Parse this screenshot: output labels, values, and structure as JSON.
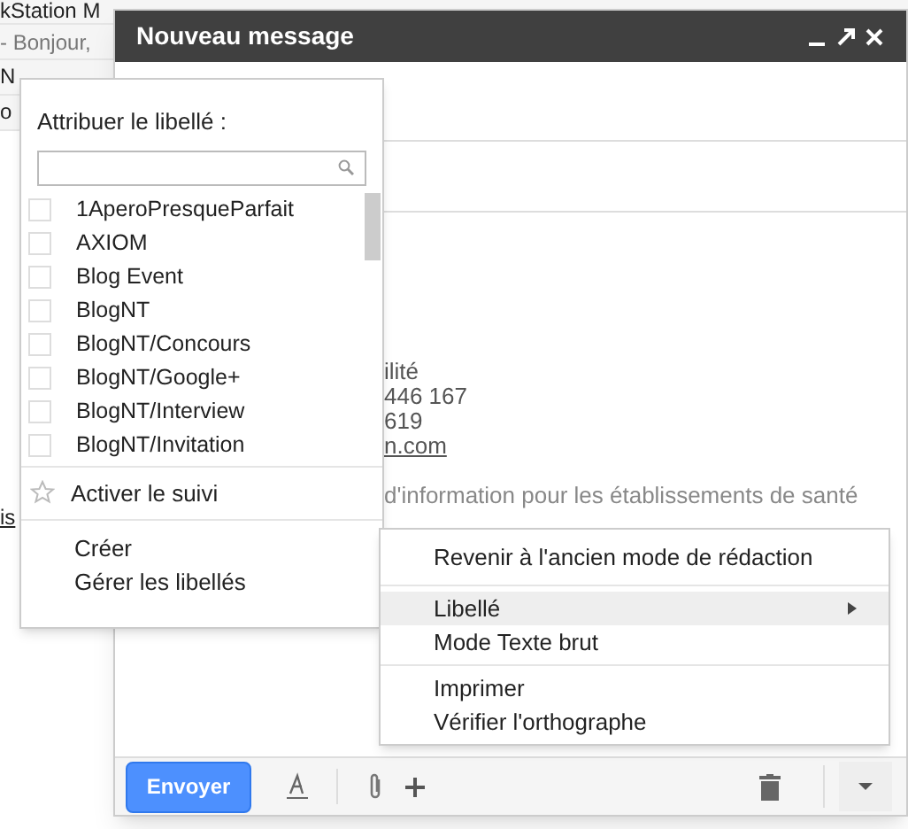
{
  "inbox_rows": [
    {
      "sender": "kStation M",
      "snippet": ""
    },
    {
      "sender": "",
      "snippet": "- Bonjour,"
    },
    {
      "sender": "N",
      "snippet": ""
    },
    {
      "sender": "o",
      "snippet": ""
    }
  ],
  "inbox_link": "is",
  "compose": {
    "title": "Nouveau message",
    "body_lines": [
      {
        "text": "ilité",
        "link": false
      },
      {
        "text": "446 167",
        "link": false
      },
      {
        "text": "619",
        "link": false
      },
      {
        "text": "n.com",
        "link": true
      }
    ],
    "footer_text": "d'information pour les établissements de santé",
    "send_label": "Envoyer"
  },
  "label_menu": {
    "title": "Attribuer le libellé :",
    "labels": [
      {
        "name": "1AperoPresqueParfait",
        "checked": false
      },
      {
        "name": "AXIOM",
        "checked": false
      },
      {
        "name": "Blog Event",
        "checked": false
      },
      {
        "name": "BlogNT",
        "checked": false
      },
      {
        "name": "BlogNT/Concours",
        "checked": false
      },
      {
        "name": "BlogNT/Google+",
        "checked": false
      },
      {
        "name": "BlogNT/Interview",
        "checked": false
      },
      {
        "name": "BlogNT/Invitation",
        "checked": false
      }
    ],
    "follow": "Activer le suivi",
    "actions": [
      "Créer",
      "Gérer les libellés"
    ]
  },
  "more_menu": {
    "groups": [
      [
        {
          "label": "Revenir à l'ancien mode de rédaction",
          "selected": false,
          "submenu": false
        }
      ],
      [
        {
          "label": "Libellé",
          "selected": true,
          "submenu": true
        },
        {
          "label": "Mode Texte brut",
          "selected": false,
          "submenu": false
        }
      ],
      [
        {
          "label": "Imprimer",
          "selected": false,
          "submenu": false
        },
        {
          "label": "Vérifier l'orthographe",
          "selected": false,
          "submenu": false
        }
      ]
    ]
  }
}
